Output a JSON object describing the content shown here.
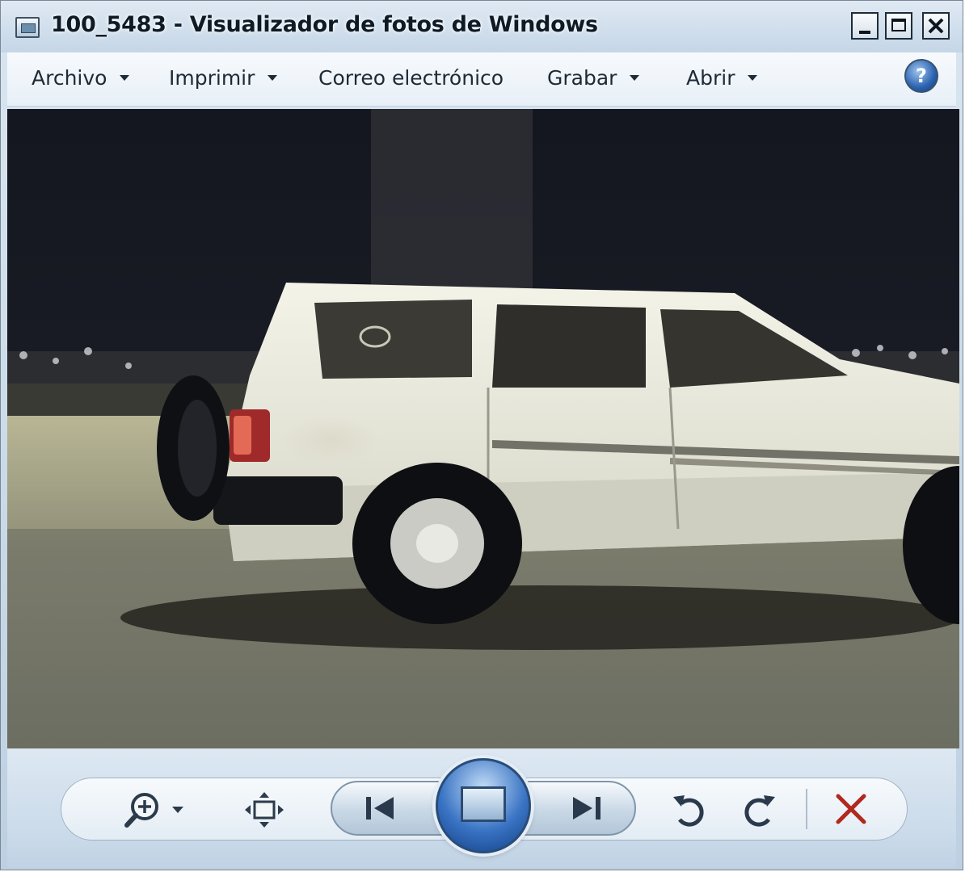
{
  "window": {
    "title": "100_5483 - Visualizador de fotos de Windows"
  },
  "menu": {
    "items": [
      {
        "label": "Archivo",
        "has_dropdown": true
      },
      {
        "label": "Imprimir",
        "has_dropdown": true
      },
      {
        "label": "Correo electrónico",
        "has_dropdown": false
      },
      {
        "label": "Grabar",
        "has_dropdown": true
      },
      {
        "label": "Abrir",
        "has_dropdown": true
      }
    ],
    "help_icon": "question-icon"
  },
  "photo": {
    "subject": "white-suv-on-road-at-night"
  },
  "controls": {
    "icons": [
      "zoom-in-icon",
      "fit-window-icon",
      "previous-icon",
      "slideshow-icon",
      "next-icon",
      "rotate-left-icon",
      "rotate-right-icon",
      "delete-icon"
    ],
    "delete_color": "#b0281e",
    "accent": "#2f66b3"
  }
}
